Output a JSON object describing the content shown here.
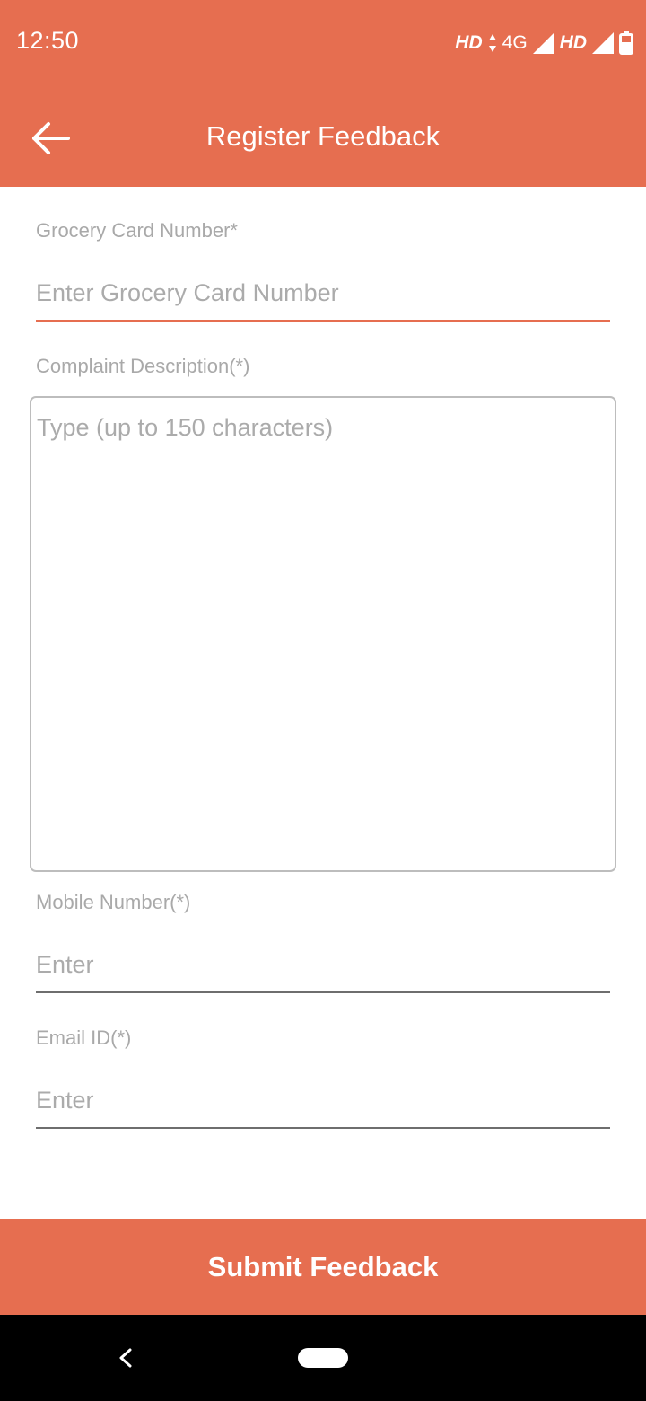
{
  "status_bar": {
    "time": "12:50",
    "hd_1": "HD",
    "network": "4G",
    "hd_2": "HD"
  },
  "header": {
    "title": "Register Feedback",
    "back_icon": "arrow-left-icon"
  },
  "form": {
    "grocery_card": {
      "label": "Grocery Card Number*",
      "placeholder": "Enter Grocery Card Number"
    },
    "complaint": {
      "label": "Complaint Description(*)",
      "placeholder": "Type (up to 150 characters)"
    },
    "mobile": {
      "label": "Mobile Number(*)",
      "placeholder": "Enter"
    },
    "email": {
      "label": "Email ID(*)",
      "placeholder": "Enter"
    }
  },
  "submit": {
    "label": "Submit Feedback"
  },
  "colors": {
    "primary": "#E66E50",
    "label_gray": "#A9A9A9",
    "nav_bar": "#000000"
  },
  "nav_bar": {
    "back_icon": "nav-back-icon",
    "home_icon": "nav-home-pill-icon"
  }
}
